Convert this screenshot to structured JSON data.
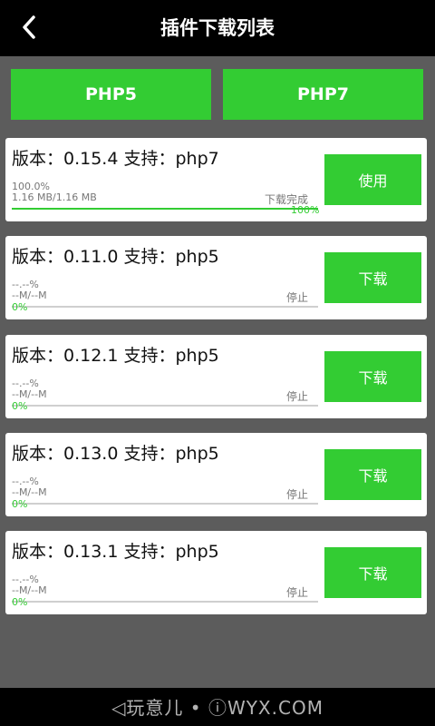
{
  "header": {
    "title": "插件下载列表",
    "back_icon": "chevron-left-icon"
  },
  "tabs": [
    {
      "label": "PHP5"
    },
    {
      "label": "PHP7"
    }
  ],
  "colors": {
    "accent": "#33cc33",
    "titlebar": "#000000",
    "background": "#5c5c5c"
  },
  "plugins": [
    {
      "heading": "版本：0.15.4 支持：php7",
      "percent_text": "100.0%",
      "size": "1.16 MB/1.16 MB",
      "status": "下载完成",
      "progress_label": "100%",
      "progress": 1.0,
      "action": "使用"
    },
    {
      "heading": "版本：0.11.0 支持：php5",
      "percent_text": "--.--%",
      "size": "--M/--M",
      "status": "停止",
      "progress_label": "0%",
      "progress": 0,
      "action": "下载"
    },
    {
      "heading": "版本：0.12.1 支持：php5",
      "percent_text": "--.--%",
      "size": "--M/--M",
      "status": "停止",
      "progress_label": "0%",
      "progress": 0,
      "action": "下载"
    },
    {
      "heading": "版本：0.13.0 支持：php5",
      "percent_text": "--.--%",
      "size": "--M/--M",
      "status": "停止",
      "progress_label": "0%",
      "progress": 0,
      "action": "下载"
    },
    {
      "heading": "版本：0.13.1 支持：php5",
      "percent_text": "--.--%",
      "size": "--M/--M",
      "status": "停止",
      "progress_label": "0%",
      "progress": 0,
      "action": "下载"
    }
  ],
  "watermark": "◁玩意儿 • ⓘWYX.COM"
}
